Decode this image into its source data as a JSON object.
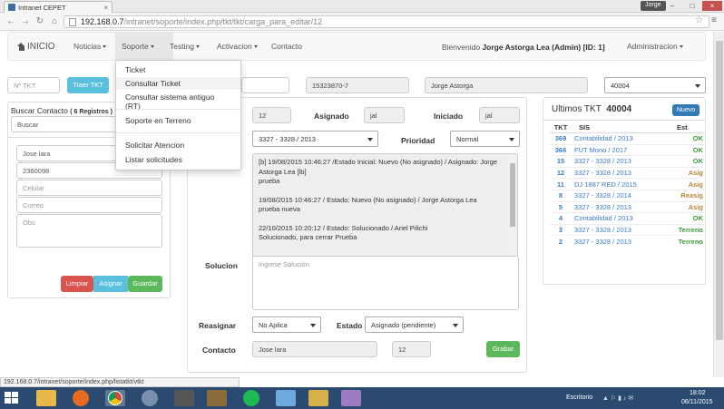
{
  "browser": {
    "tab_title": "Intranet CEPET",
    "user": "Jorge",
    "url_host": "192.168.0.7",
    "url_path": "/intranet/soporte/index.php/tkt/tkt/carga_para_editar/12"
  },
  "navbar": {
    "brand": "INICIO",
    "items": [
      "Noticias",
      "Soporte",
      "Testing",
      "Activacion",
      "Contacto"
    ],
    "welcome_prefix": "Bienvenido",
    "welcome_user": "Jorge Astorga Lea (Admin) [ID: 1]",
    "admin": "Administracion"
  },
  "dropdown": {
    "items": [
      "Ticket",
      "Consultar Ticket",
      "Consultar sistema antiguo (RT)",
      "Soporte en Terreno",
      "Solicitar Atencion",
      "Listar solicitudes"
    ]
  },
  "top_form": {
    "ntkt_placeholder": "Nº TKT",
    "traer_button": "Traer TKT",
    "rut": "15323870-7",
    "name": "Jorge Astorga",
    "anexo": "40004"
  },
  "contact_panel": {
    "title": "Buscar Contacto",
    "count": "( 6 Registros )",
    "search_placeholder": "Buscar",
    "name_value": "Jose lara",
    "phone_value": "2360098",
    "celular_placeholder": "Celular",
    "correo_placeholder": "Correo",
    "obs_placeholder": "Obs",
    "btn_limpiar": "Limpiar",
    "btn_asignar": "Asignar",
    "btn_guardar": "Guardar"
  },
  "ticket": {
    "id": "12",
    "asignado_label": "Asignado",
    "asignado_value": "jal",
    "iniciado_label": "Iniciado",
    "iniciado_value": "jal",
    "sistema": "3327 - 3328 / 2013",
    "prioridad_label": "Prioridad",
    "prioridad": "Normal",
    "log": [
      "[b] 19/08/2015 10:46:27 /Estado Inicial: Nuevo (No asignado) / Asignado: Jorge Astorga Lea [lb]",
      "prueba",
      "",
      "19/08/2015 10:46:27 / Estado: Nuevo (No asignado) / Jorge Astorga Lea",
      "prueba nueva",
      "",
      "22/10/2015 10:20:12 / Estado: Solucionado / Ariel Pilichi",
      "Solucionado, para cerrar Prueba"
    ],
    "solucion_label": "Solucion",
    "solucion_placeholder": "Ingrese Solución",
    "reasignar_label": "Reasignar",
    "reasignar_value": "No Aplica",
    "estado_label": "Estado",
    "estado_value": "Asignado (pendiente)",
    "contacto_label": "Contacto",
    "contacto_value": "Jose lara",
    "contacto_id": "12",
    "grabar": "Grabar"
  },
  "ultimos": {
    "title": "Ultimos TKT",
    "number": "40004",
    "nuevo": "Nuevo",
    "headers": [
      "TKT",
      "SIS",
      "Est"
    ],
    "rows": [
      {
        "tkt": "369",
        "sis": "Contabilidad / 2013",
        "est": "OK"
      },
      {
        "tkt": "366",
        "sis": "FUT Mono / 2017",
        "est": "OK"
      },
      {
        "tkt": "15",
        "sis": "3327 - 3328 / 2013",
        "est": "OK"
      },
      {
        "tkt": "12",
        "sis": "3327 - 3328 / 2013",
        "est": "Asig"
      },
      {
        "tkt": "11",
        "sis": "DJ 1887 RED / 2015",
        "est": "Asig"
      },
      {
        "tkt": "8",
        "sis": "3327 - 3328 / 2014",
        "est": "Reasig"
      },
      {
        "tkt": "5",
        "sis": "3327 - 3328 / 2013",
        "est": "Asig"
      },
      {
        "tkt": "4",
        "sis": "Contabilidad / 2013",
        "est": "OK"
      },
      {
        "tkt": "3",
        "sis": "3327 - 3328 / 2013",
        "est": "Terreno"
      },
      {
        "tkt": "2",
        "sis": "3327 - 3328 / 2013",
        "est": "Terreno"
      }
    ]
  },
  "statusbar": "192.168.0.7/intranet/soporte/index.php/listatkt/vtkt",
  "taskbar": {
    "desktop_label": "Escritorio",
    "time": "18:02",
    "date": "06/11/2015"
  }
}
